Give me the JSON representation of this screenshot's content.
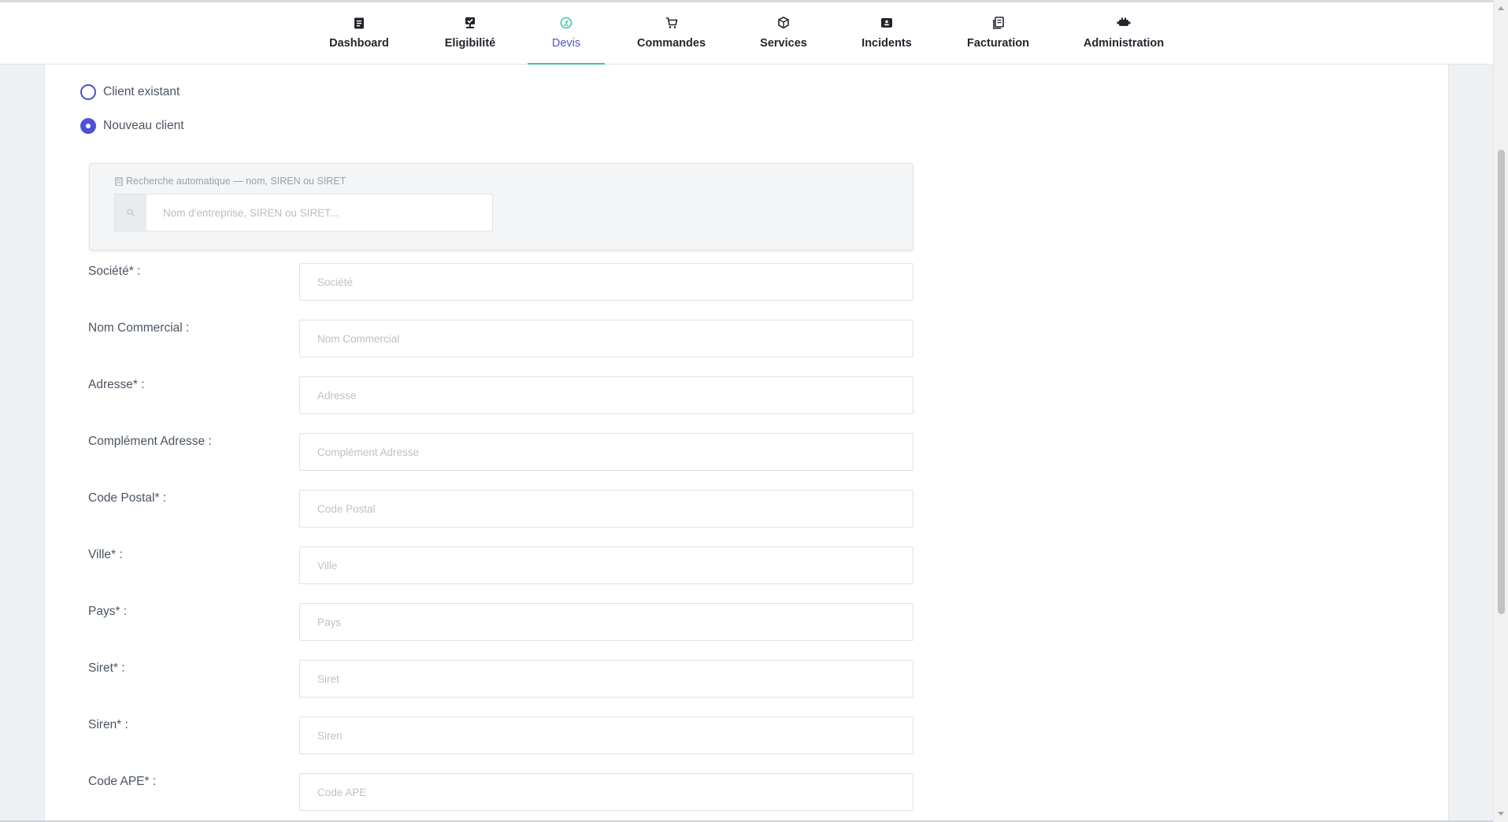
{
  "nav": {
    "items": [
      {
        "label": "Dashboard",
        "icon": "dashboard-icon"
      },
      {
        "label": "Eligibilité",
        "icon": "eligibility-icon"
      },
      {
        "label": "Devis",
        "icon": "devis-gauge-icon",
        "active": true
      },
      {
        "label": "Commandes",
        "icon": "cart-icon"
      },
      {
        "label": "Services",
        "icon": "box-icon"
      },
      {
        "label": "Incidents",
        "icon": "ticket-icon"
      },
      {
        "label": "Facturation",
        "icon": "invoice-icon"
      },
      {
        "label": "Administration",
        "icon": "gears-icon"
      }
    ],
    "active_color": "#5055c9",
    "underline_color": "#3cc6a8"
  },
  "client_type": {
    "options": [
      {
        "label": "Client existant",
        "checked": false
      },
      {
        "label": "Nouveau client",
        "checked": true
      }
    ],
    "accent": "#4f52d8"
  },
  "search": {
    "title": "Recherche automatique — nom, SIREN ou SIRET",
    "placeholder": "Nom d'entreprise, SIREN ou SIRET..."
  },
  "fields": [
    {
      "label": "Société* :",
      "placeholder": "Société"
    },
    {
      "label": "Nom Commercial :",
      "placeholder": "Nom Commercial"
    },
    {
      "label": "Adresse* :",
      "placeholder": "Adresse"
    },
    {
      "label": "Complément Adresse :",
      "placeholder": "Complément Adresse"
    },
    {
      "label": "Code Postal* :",
      "placeholder": "Code Postal"
    },
    {
      "label": "Ville* :",
      "placeholder": "Ville"
    },
    {
      "label": "Pays* :",
      "placeholder": "Pays"
    },
    {
      "label": "Siret* :",
      "placeholder": "Siret"
    },
    {
      "label": "Siren* :",
      "placeholder": "Siren"
    },
    {
      "label": "Code APE* :",
      "placeholder": "Code APE"
    }
  ]
}
